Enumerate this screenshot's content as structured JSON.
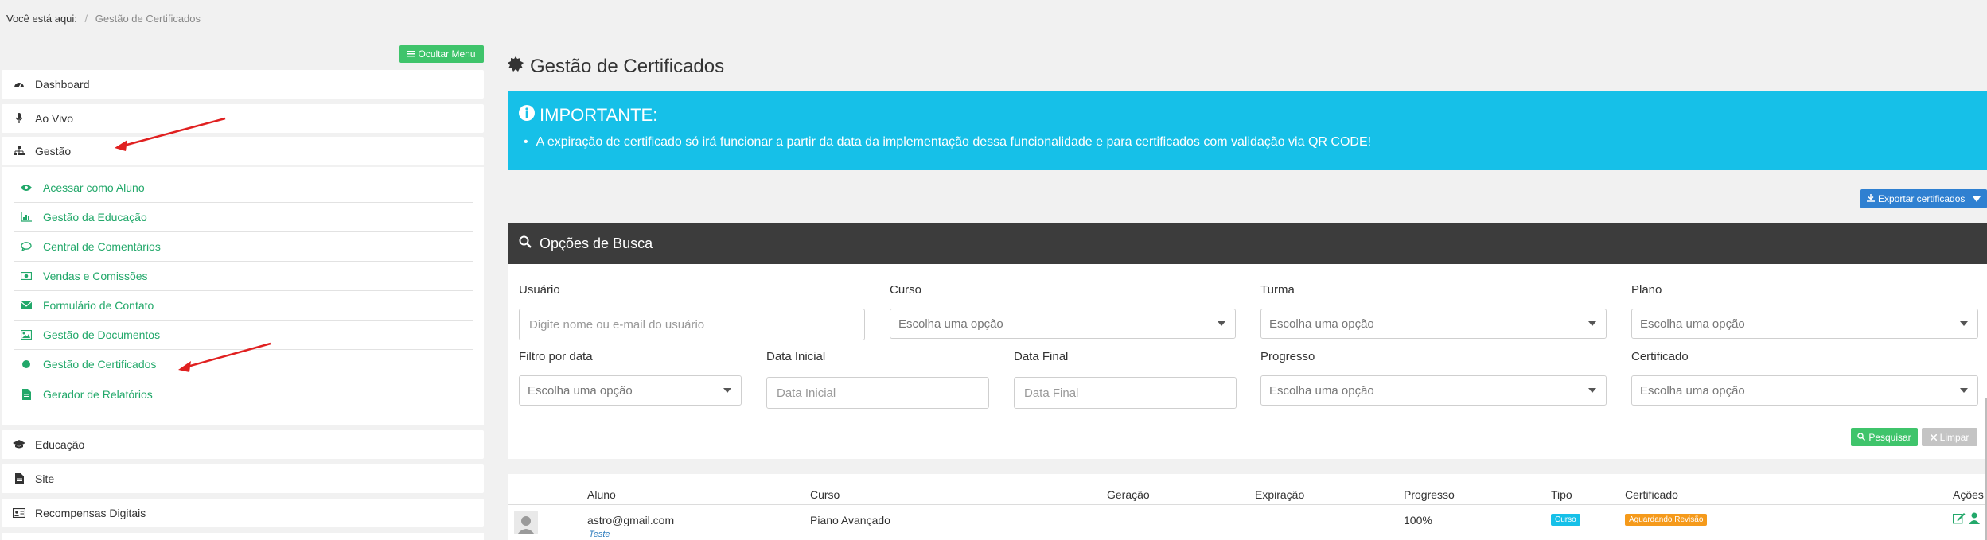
{
  "breadcrumb": {
    "prefix": "Você está aqui:",
    "separator": "/",
    "current": "Gestão de Certificados"
  },
  "sidebar": {
    "hide_menu_label": "Ocultar Menu",
    "items": [
      {
        "label": "Dashboard",
        "icon": "dashboard-icon"
      },
      {
        "label": "Ao Vivo",
        "icon": "microphone-icon"
      },
      {
        "label": "Gestão",
        "icon": "sitemap-icon"
      }
    ],
    "submenu": [
      {
        "label": "Acessar como Aluno",
        "icon": "eye-icon"
      },
      {
        "label": "Gestão da Educação",
        "icon": "bar-chart-icon"
      },
      {
        "label": "Central de Comentários",
        "icon": "comment-icon"
      },
      {
        "label": "Vendas e Comissões",
        "icon": "money-icon"
      },
      {
        "label": "Formulário de Contato",
        "icon": "envelope-icon"
      },
      {
        "label": "Gestão de Documentos",
        "icon": "image-icon"
      },
      {
        "label": "Gestão de Certificados",
        "icon": "circle-icon"
      },
      {
        "label": "Gerador de Relatórios",
        "icon": "file-icon"
      }
    ],
    "bottom_items": [
      {
        "label": "Educação",
        "icon": "graduation-cap-icon"
      },
      {
        "label": "Site",
        "icon": "file-text-icon"
      },
      {
        "label": "Recompensas Digitais",
        "icon": "id-card-icon"
      }
    ]
  },
  "main": {
    "title": "Gestão de Certificados",
    "alert": {
      "title": "IMPORTANTE:",
      "bullet": "•",
      "text": "A expiração de certificado só irá funcionar a partir da data da implementação dessa funcionalidade e para certificados com validação via QR CODE!"
    },
    "export_label": "Exportar certificados",
    "search": {
      "header": "Opções de Busca",
      "fields": {
        "usuario": {
          "label": "Usuário",
          "placeholder": "Digite nome ou e-mail do usuário"
        },
        "curso": {
          "label": "Curso",
          "value": "Escolha uma opção"
        },
        "turma": {
          "label": "Turma",
          "value": "Escolha uma opção"
        },
        "plano": {
          "label": "Plano",
          "value": "Escolha uma opção"
        },
        "filtro_data": {
          "label": "Filtro por data",
          "value": "Escolha uma opção"
        },
        "data_inicial": {
          "label": "Data Inicial",
          "placeholder": "Data Inicial"
        },
        "data_final": {
          "label": "Data Final",
          "placeholder": "Data Final"
        },
        "progresso": {
          "label": "Progresso",
          "value": "Escolha uma opção"
        },
        "certificado": {
          "label": "Certificado",
          "value": "Escolha uma opção"
        }
      },
      "search_button": "Pesquisar",
      "clear_button": "Limpar"
    },
    "table": {
      "columns": [
        "Aluno",
        "Curso",
        "Geração",
        "Expiração",
        "Progresso",
        "Tipo",
        "Certificado",
        "Ações"
      ],
      "rows": [
        {
          "aluno": "astro@gmail.com",
          "aluno_sub": "Teste",
          "curso": "Piano Avançado",
          "geracao": "",
          "expiracao": "",
          "progresso": "100%",
          "tipo": "Curso",
          "certificado": "Aguardando Revisão"
        }
      ]
    }
  },
  "colors": {
    "accent_green": "#3fc46b",
    "link_green": "#22a86a",
    "alert_cyan": "#16c0e8",
    "header_dark": "#3c3c3c",
    "export_blue": "#2f80d1",
    "badge_cyan": "#16c0e8",
    "badge_orange": "#f59a1b",
    "arrow_red": "#e02020"
  }
}
